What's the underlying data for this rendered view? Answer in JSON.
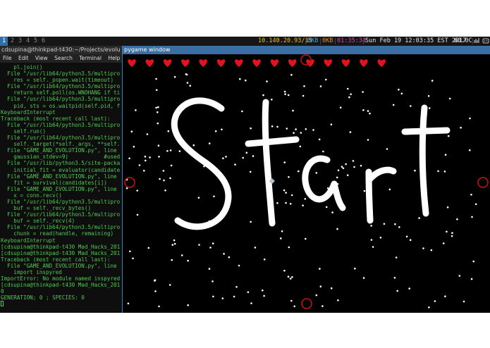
{
  "statusbar": {
    "workspaces": [
      "1",
      "2",
      "3",
      "4",
      "5",
      "6"
    ],
    "active_workspace": "1",
    "ip": "10.140.20.93/15",
    "net_down": "0KB",
    "net_up": "0KB",
    "timer": "01:35:34",
    "datetime": "Sun Feb 19 12:03:35 EST 2017",
    "temp": "60.0C"
  },
  "terminal": {
    "title": "cdsupina@thinkpad-t430:~/Projects/evolu",
    "menu": [
      "File",
      "Edit",
      "View",
      "Search",
      "Terminal",
      "Help"
    ],
    "lines": [
      "    pl.join()",
      "  File \"/usr/lib64/python3.5/multipro",
      "    res = self._popen.wait(timeout)",
      "  File \"/usr/lib64/python3.5/multipro",
      "    return self.poll(os.WNOHANG if ti",
      "  File \"/usr/lib64/python3.5/multipro",
      "    pid, sts = os.waitpid(self.pid, f",
      "KeyboardInterrupt",
      "Traceback (most recent call last):",
      "  File \"/usr/lib64/python3.5/multipro",
      "    self.run()",
      "  File \"/usr/lib64/python3.5/multipro",
      "    self._target(*self._args, **self.",
      "  File \"GAME_AND_EVOLUTION.py\", line",
      "    gaussian_stdev=9)           #used",
      "  File \"/usr/lib/python3.5/site-packa",
      "    initial_fit = evaluator(candidate",
      "  File \"GAME_AND_EVOLUTION.py\", line",
      "    fit = survival(candidates[i])",
      "  File \"GAME_AND_EVOLUTION.py\", line",
      "    x = conn.recv()",
      "  File \"/usr/lib64/python3.5/multipro",
      "    buf = self._recv_bytes()",
      "  File \"/usr/lib64/python3.5/multipro",
      "    buf = self._recv(4)",
      "  File \"/usr/lib64/python3.5/multipro",
      "    chunk = read(handle, remaining)",
      "KeyboardInterrupt",
      "[cdsupina@thinkpad-t430 Mad_Hacks_201",
      "[cdsupina@thinkpad-t430 Mad_Hacks_201",
      "Traceback (most recent call last):",
      "  File \"GAME_AND_EVOLUTION.py\", line",
      "    import inspyred",
      "ImportError: No module named inspyred",
      "[cdsupina@thinkpad-t430 Mad_Hacks_201",
      "0",
      "GENERATION; 0 ; SPECIES: 0"
    ]
  },
  "pygame": {
    "title": "pygame window",
    "lives_count": 15,
    "heart_color": "#e0141e",
    "enemy_ring_color": "#c81414",
    "handwritten_text": "Start"
  }
}
